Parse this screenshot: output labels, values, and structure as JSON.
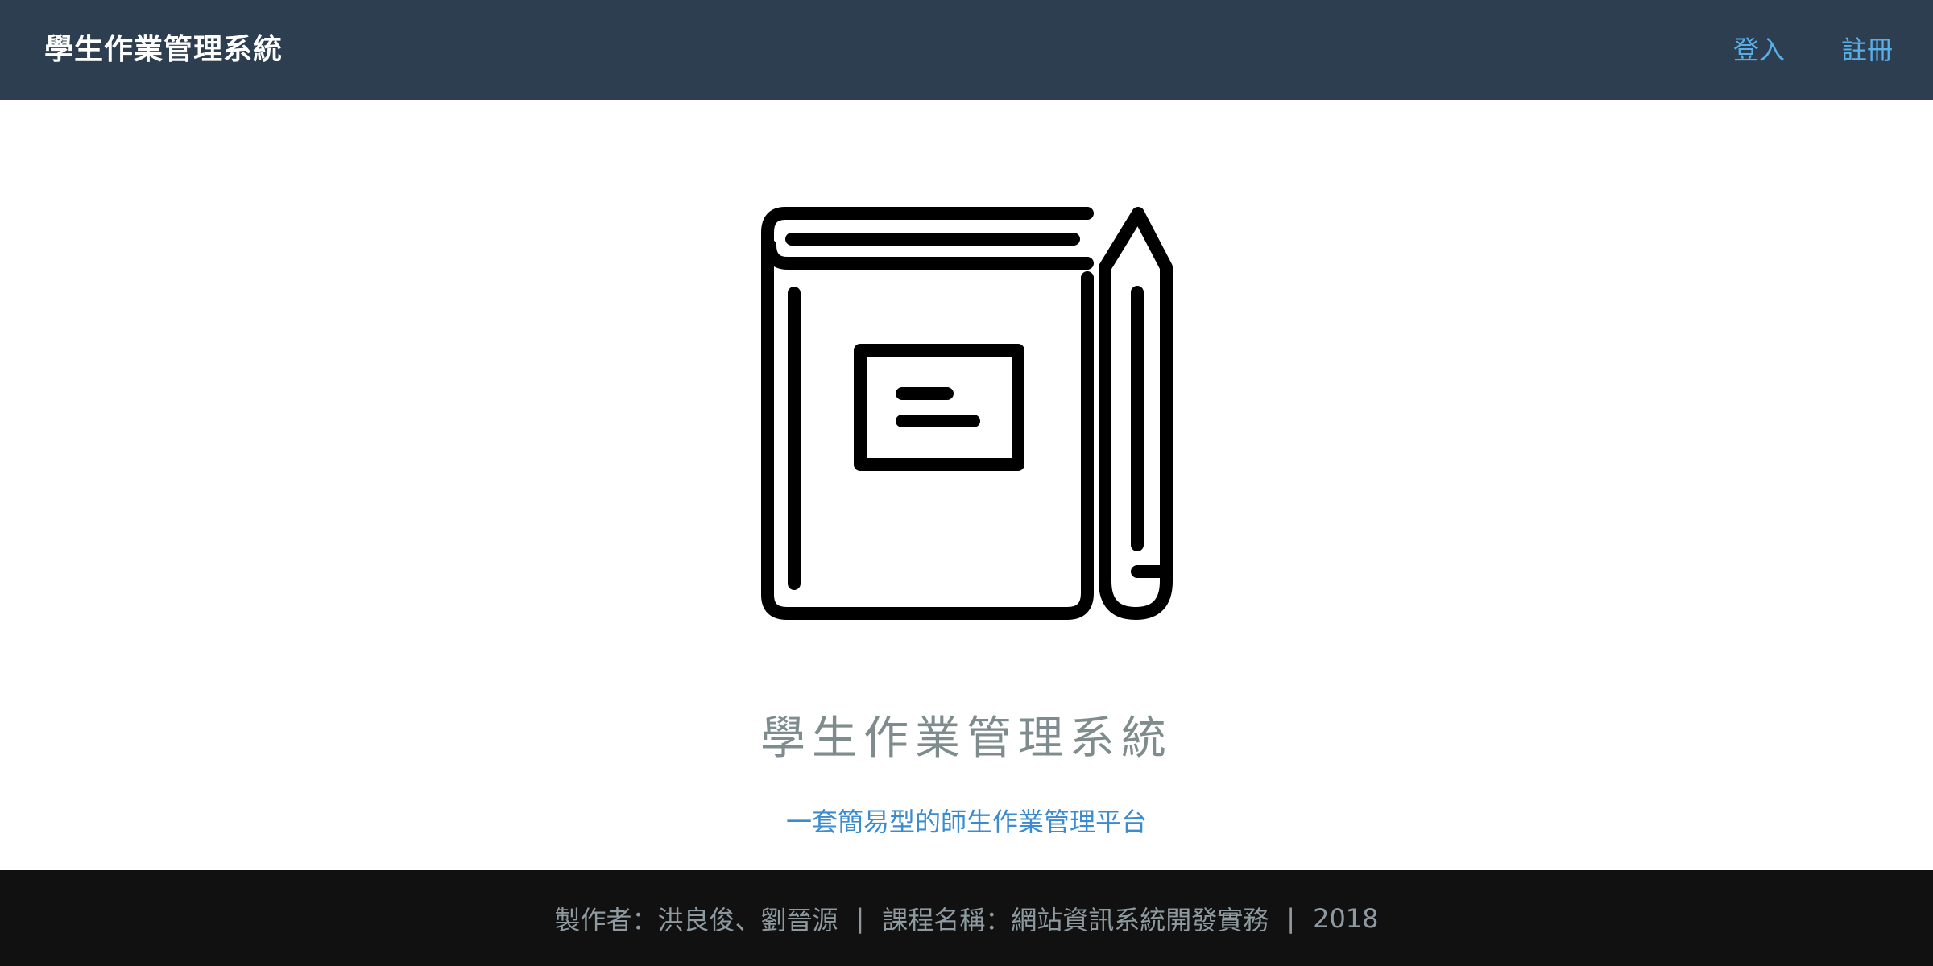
{
  "navbar": {
    "brand": "學生作業管理系統",
    "links": [
      {
        "label": "登入"
      },
      {
        "label": "註冊"
      }
    ]
  },
  "hero": {
    "icon": "notebook-pencil-icon",
    "title": "學生作業管理系統",
    "subtitle": "一套簡易型的師生作業管理平台"
  },
  "footer": {
    "authors": "製作者：洪良俊、劉晉源",
    "separator": "|",
    "course": "課程名稱：網站資訊系統開發實務",
    "year": "2018"
  },
  "colors": {
    "navbar_bg": "#2c3e50",
    "link": "#5aaee6",
    "subtitle": "#3a8bd0",
    "title": "#7f8c8d",
    "footer_bg": "#111111"
  }
}
